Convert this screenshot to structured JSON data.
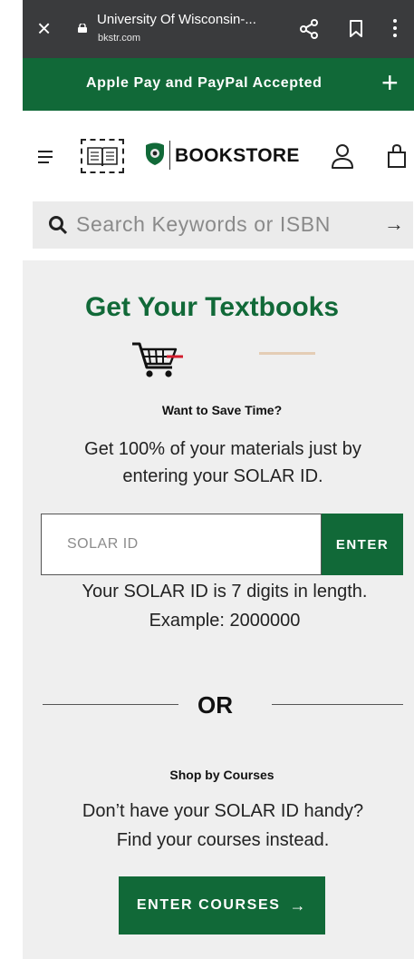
{
  "browser": {
    "tab_title": "University Of Wisconsin-...",
    "domain": "bkstr.com",
    "close_label": "×"
  },
  "promo": {
    "text": "Apple Pay and PayPal Accepted",
    "expand_label": "+"
  },
  "header": {
    "store_name": "BOOKSTORE"
  },
  "search": {
    "placeholder": "Search Keywords or ISBN",
    "submit_label": "→"
  },
  "main": {
    "title": "Get Your Textbooks",
    "save_time_heading": "Want to Save Time?",
    "save_time_desc_line1": "Get 100% of your materials just by",
    "save_time_desc_line2": "entering your SOLAR ID.",
    "solar_placeholder": "SOLAR ID",
    "enter_label": "ENTER",
    "hint_line1": "Your SOLAR ID is 7 digits in length.",
    "hint_line2": "Example: 2000000",
    "or_label": "OR",
    "shop_heading": "Shop by Courses",
    "shop_desc_line1": "Don’t have your SOLAR ID handy?",
    "shop_desc_line2": "Find your courses instead.",
    "courses_button_label": "ENTER COURSES",
    "courses_button_arrow": "→"
  },
  "colors": {
    "brand_green": "#116938",
    "browser_bar": "#3a3b3d",
    "accent_tan": "#e4cdb5"
  },
  "icons": [
    "close-icon",
    "lock-icon",
    "share-icon",
    "bookmark-icon",
    "more-menu-icon",
    "plus-icon",
    "hamburger-icon",
    "university-logo",
    "bookstore-badge-icon",
    "user-icon",
    "shopping-bag-icon",
    "search-icon",
    "arrow-right-icon",
    "cart-icon"
  ]
}
